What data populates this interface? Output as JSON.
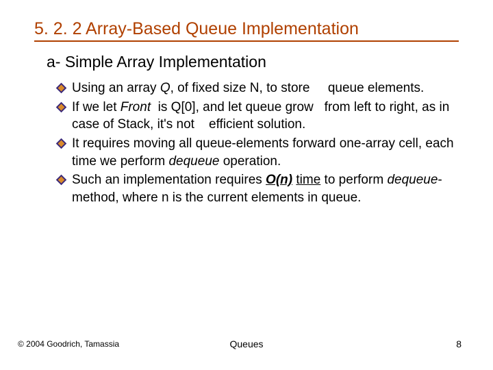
{
  "title": "5. 2. 2 Array-Based Queue Implementation",
  "subtitle": "a- Simple Array Implementation",
  "bullets": {
    "b1": {
      "t1": "Using an array ",
      "q": "Q",
      "t2": ", of fixed size N, to store     queue elements."
    },
    "b2": {
      "t1": "If we let ",
      "front": "Front",
      "t2": "  is Q[0], and let queue grow   from left to right, as in case of Stack, it's not    efficient solution."
    },
    "b3": {
      "t1": "It requires moving all queue-elements forward one-array cell, each time we perform ",
      "deq": "dequeue",
      "t2": " operation."
    },
    "b4": {
      "t1": "Such an implementation requires ",
      "on": "O(n)",
      "sp": " ",
      "time": "time",
      "t2": " to perform ",
      "deq": "dequeue",
      "t3": "-method, where n is the current elements in queue."
    }
  },
  "footer": {
    "copyright": "© 2004 Goodrich, Tamassia",
    "center": "Queues",
    "page": "8"
  }
}
